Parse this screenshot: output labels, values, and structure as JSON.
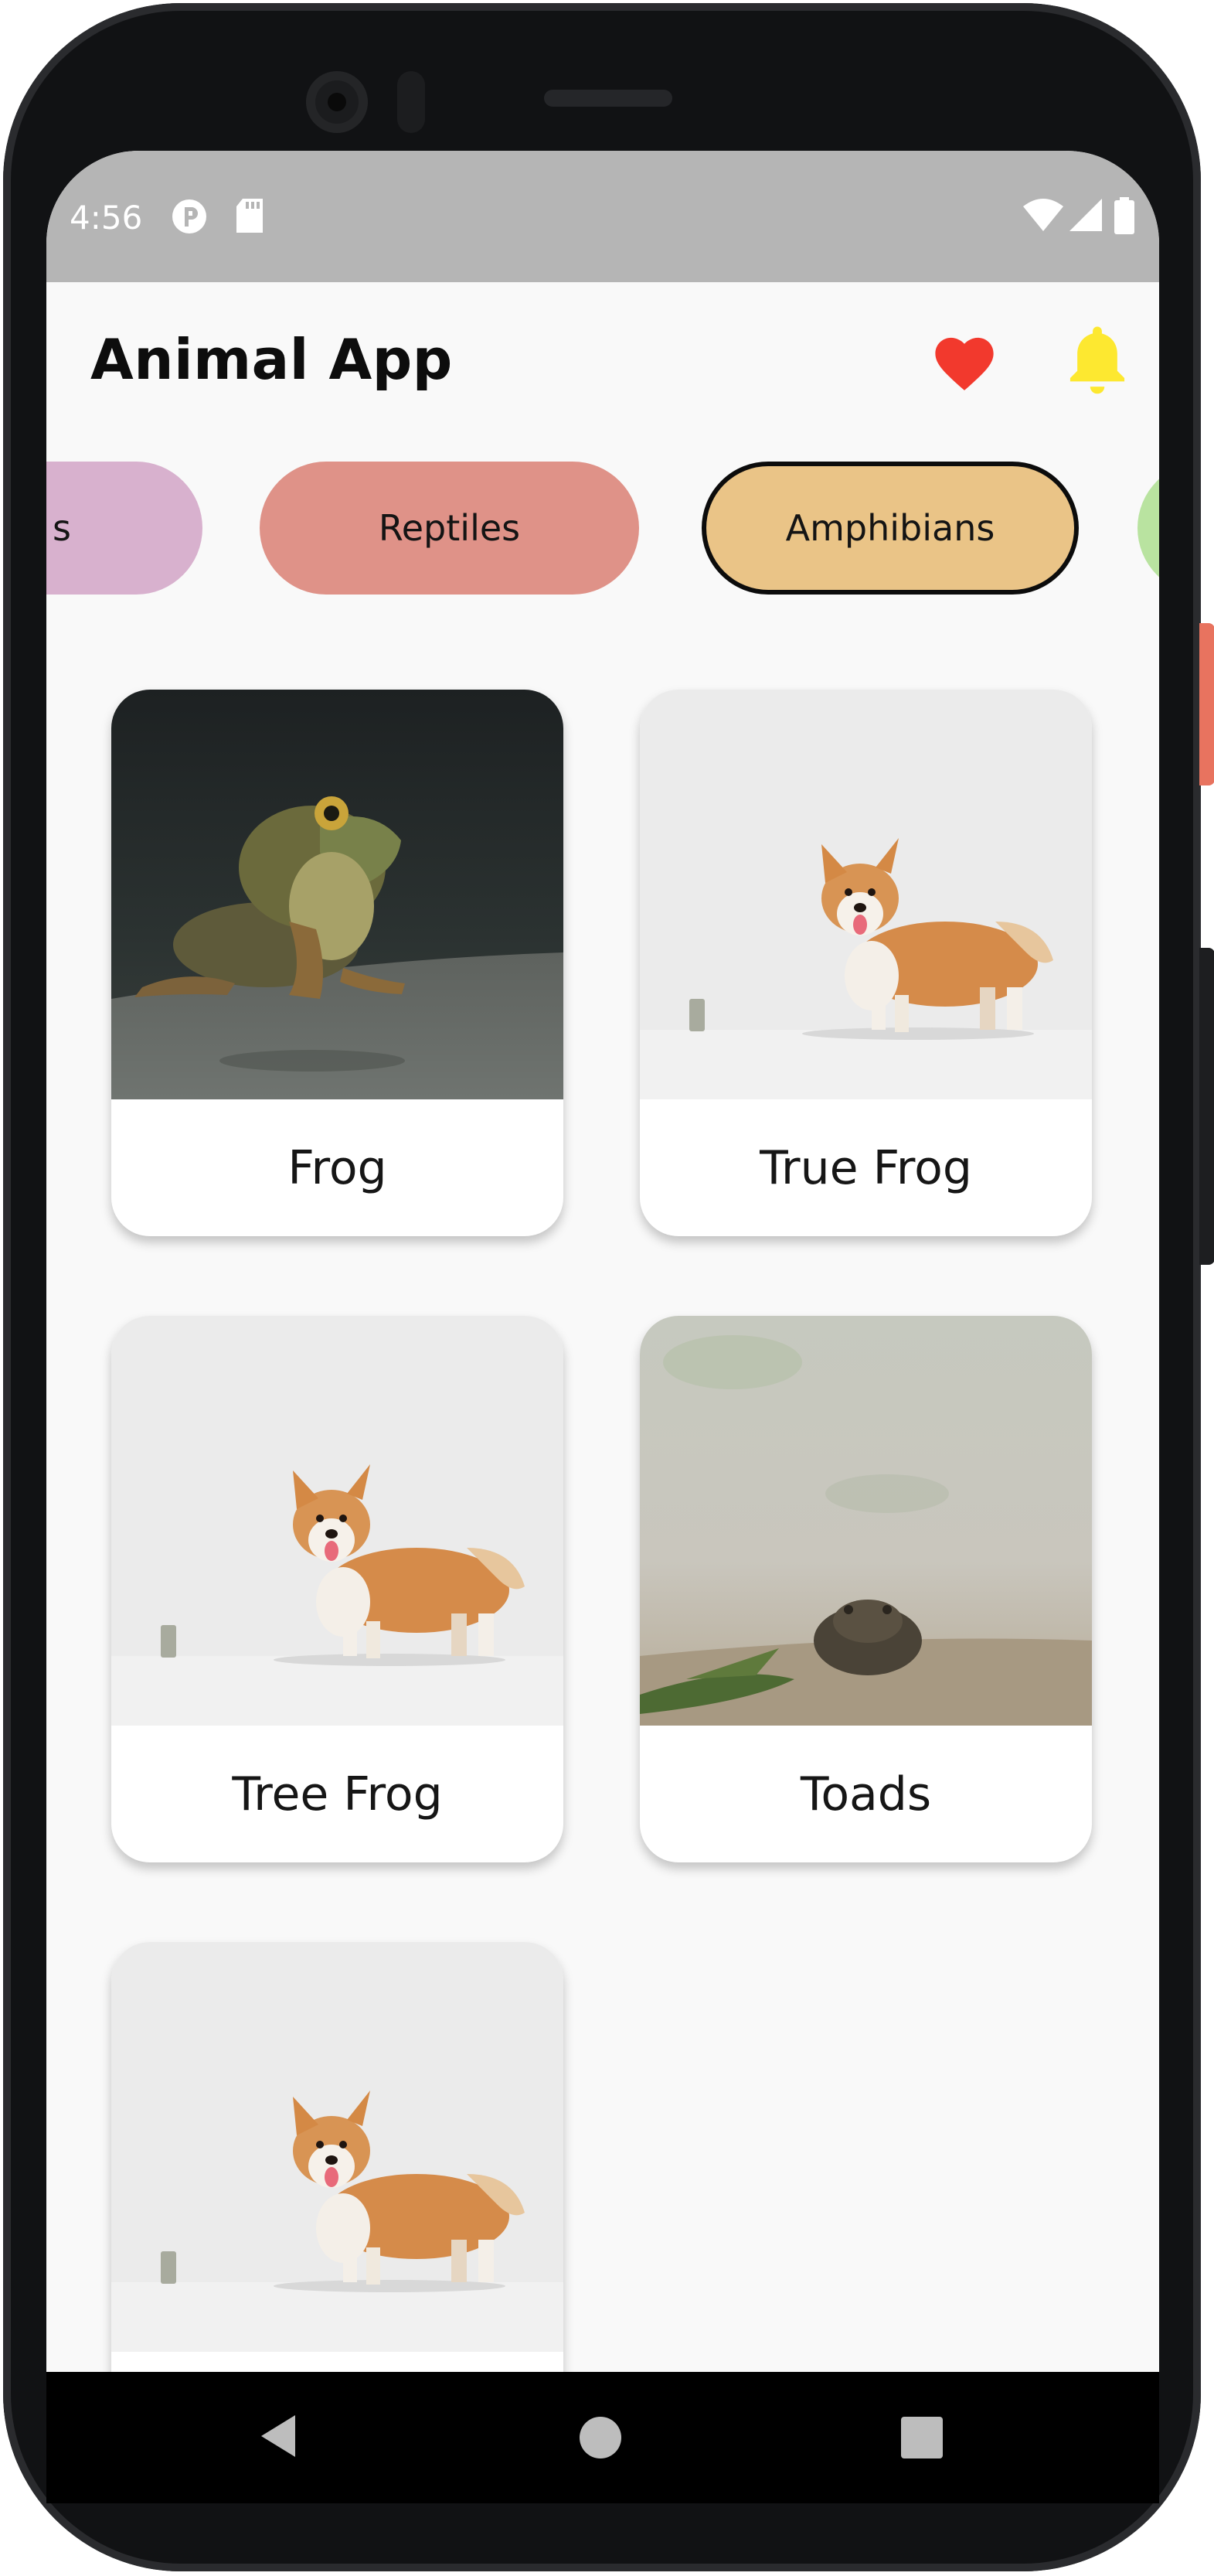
{
  "status_bar": {
    "time": "4:56",
    "icons": [
      "circle-p-icon",
      "sd-card-icon",
      "wifi-icon",
      "signal-icon",
      "battery-icon"
    ]
  },
  "app_bar": {
    "title": "Animal App",
    "favorite_icon": "heart-icon",
    "notification_icon": "bell-icon",
    "colors": {
      "heart": "#f2392d",
      "bell": "#fde830"
    }
  },
  "categories": [
    {
      "label": "Mammals",
      "visible_text": "s",
      "color": "#d8b1ce",
      "selected": false
    },
    {
      "label": "Reptiles",
      "color": "#df9288",
      "selected": false
    },
    {
      "label": "Amphibians",
      "color": "#eac487",
      "selected": true
    },
    {
      "label": "",
      "color": "#b9e3a0",
      "selected": false
    }
  ],
  "animals": [
    {
      "name": "Frog",
      "image": "frog-photo"
    },
    {
      "name": "True Frog",
      "image": "corgi-photo"
    },
    {
      "name": "Tree Frog",
      "image": "corgi-photo"
    },
    {
      "name": "Toads",
      "image": "toad-photo"
    },
    {
      "name": "",
      "image": "corgi-photo"
    }
  ],
  "nav_bar": {
    "back_icon": "back-triangle-icon",
    "home_icon": "home-circle-icon",
    "recents_icon": "recents-square-icon"
  }
}
